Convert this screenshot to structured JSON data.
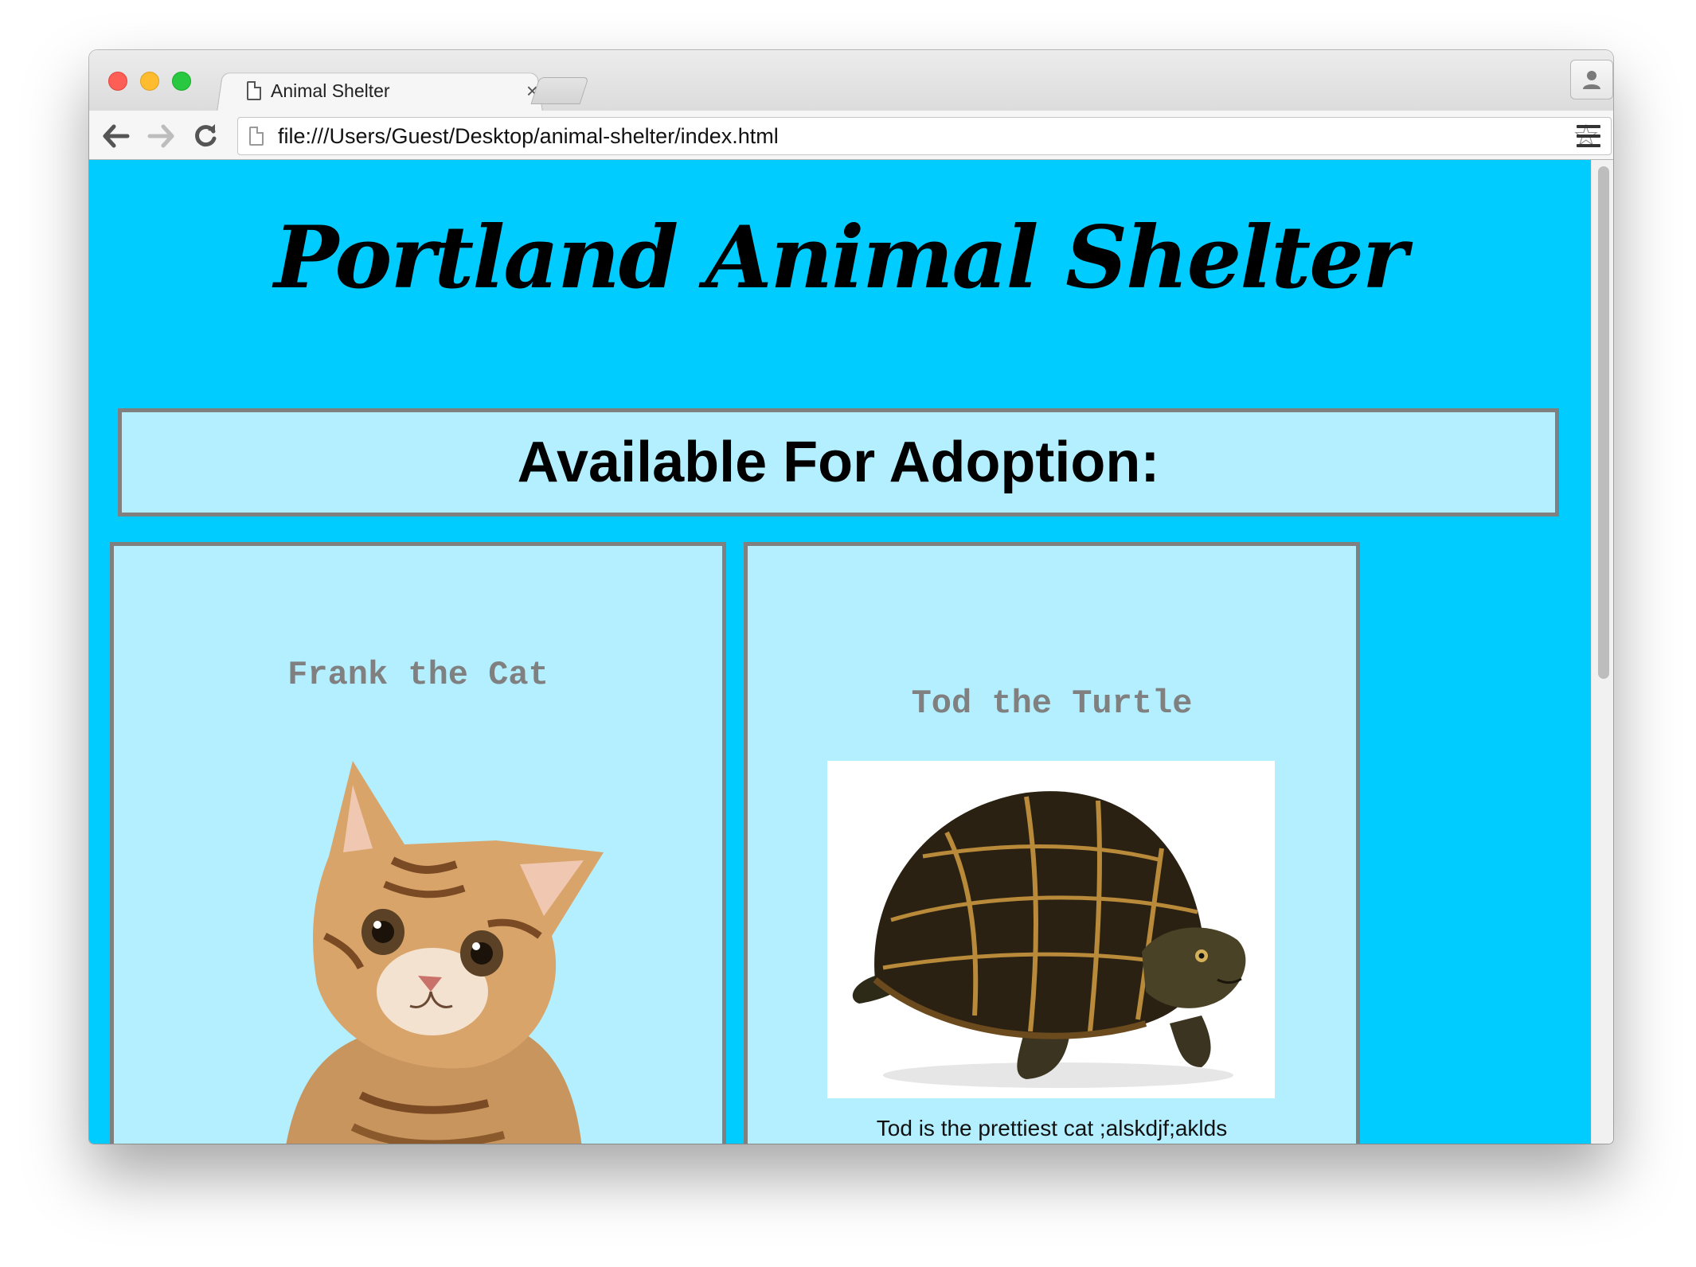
{
  "browser": {
    "tab_title": "Animal Shelter",
    "tab_close_glyph": "×",
    "url": "file:///Users/Guest/Desktop/animal-shelter/index.html",
    "star_glyph": "☆"
  },
  "page": {
    "site_title": "Portland Animal Shelter",
    "section_heading": "Available For Adoption:",
    "pets": [
      {
        "name": "Frank the Cat",
        "description": ""
      },
      {
        "name": "Tod the Turtle",
        "description": "Tod is the prettiest cat ;alskdjf;aklds"
      }
    ]
  },
  "colors": {
    "page_background": "#00ccff",
    "card_background": "#b3efff",
    "card_border": "#808080",
    "pet_name_text": "#808080"
  },
  "icons": {
    "tab": "page-icon",
    "nav": [
      "back-arrow-icon",
      "forward-arrow-icon",
      "reload-icon"
    ],
    "omnibox": [
      "page-icon",
      "star-icon"
    ],
    "toolbar_right": [
      "menu-icon",
      "profile-icon"
    ]
  }
}
